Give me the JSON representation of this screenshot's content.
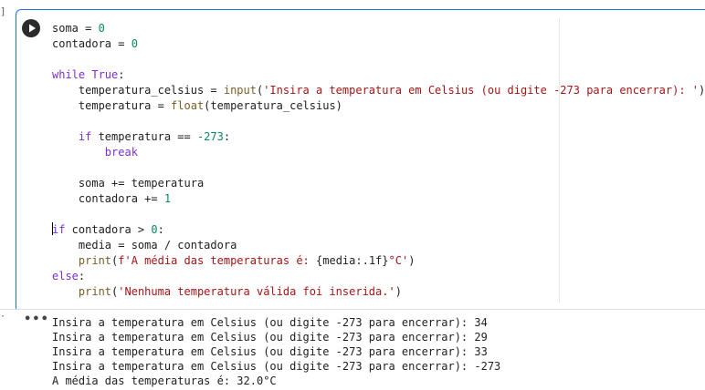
{
  "cell": {
    "execution_marker": "]",
    "code_lines": [
      [
        {
          "t": "soma = "
        },
        {
          "t": "0",
          "c": "num"
        }
      ],
      [
        {
          "t": "contadora = "
        },
        {
          "t": "0",
          "c": "num"
        }
      ],
      [],
      [
        {
          "t": "while ",
          "c": "kw"
        },
        {
          "t": "True",
          "c": "kw"
        },
        {
          "t": ":"
        }
      ],
      [
        {
          "t": "    temperatura_celsius = "
        },
        {
          "t": "input",
          "c": "fn"
        },
        {
          "t": "("
        },
        {
          "t": "'Insira a temperatura em Celsius (ou digite -273 para encerrar): '",
          "c": "str"
        },
        {
          "t": ")"
        }
      ],
      [
        {
          "t": "    temperatura = "
        },
        {
          "t": "float",
          "c": "fn"
        },
        {
          "t": "(temperatura_celsius)"
        }
      ],
      [],
      [
        {
          "t": "    "
        },
        {
          "t": "if",
          "c": "kw"
        },
        {
          "t": " temperatura == "
        },
        {
          "t": "-273",
          "c": "num"
        },
        {
          "t": ":"
        }
      ],
      [
        {
          "t": "        "
        },
        {
          "t": "break",
          "c": "kw"
        }
      ],
      [],
      [
        {
          "t": "    soma += temperatura"
        }
      ],
      [
        {
          "t": "    contadora += "
        },
        {
          "t": "1",
          "c": "num"
        }
      ],
      [],
      [
        {
          "t": "",
          "cursor": true
        },
        {
          "t": "if",
          "c": "kw"
        },
        {
          "t": " contadora > "
        },
        {
          "t": "0",
          "c": "num"
        },
        {
          "t": ":"
        }
      ],
      [
        {
          "t": "    media = soma / contadora"
        }
      ],
      [
        {
          "t": "    "
        },
        {
          "t": "print",
          "c": "fn"
        },
        {
          "t": "("
        },
        {
          "t": "f'A média das temperaturas é: ",
          "c": "str"
        },
        {
          "t": "{media:.1f}"
        },
        {
          "t": "°C'",
          "c": "str"
        },
        {
          "t": ")"
        }
      ],
      [
        {
          "t": "else",
          "c": "kw"
        },
        {
          "t": ":"
        }
      ],
      [
        {
          "t": "    "
        },
        {
          "t": "print",
          "c": "fn"
        },
        {
          "t": "("
        },
        {
          "t": "'Nenhuma temperatura válida foi inserida.'",
          "c": "str"
        },
        {
          "t": ")"
        }
      ]
    ],
    "colors": {
      "keyword": "#7b30d0",
      "number": "#098658",
      "function": "#795e26",
      "string": "#a31515",
      "focus_border": "#1a73e8"
    }
  },
  "output": {
    "marker": "·",
    "menu_label": "•••",
    "lines": [
      "Insira a temperatura em Celsius (ou digite -273 para encerrar): 34",
      "Insira a temperatura em Celsius (ou digite -273 para encerrar): 29",
      "Insira a temperatura em Celsius (ou digite -273 para encerrar): 33",
      "Insira a temperatura em Celsius (ou digite -273 para encerrar): -273",
      "A média das temperaturas é: 32.0°C"
    ]
  },
  "icons": {
    "run": "play-circle-icon",
    "output_menu": "more-horiz-icon"
  }
}
